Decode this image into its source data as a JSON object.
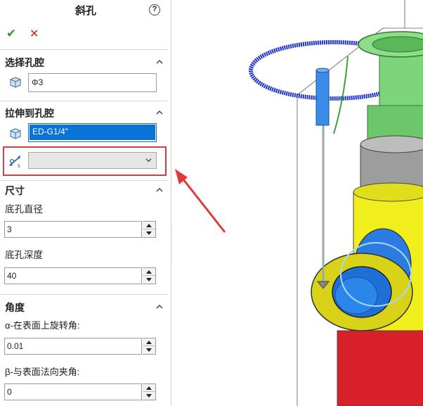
{
  "panel": {
    "title": "斜孔",
    "help_icon": "?",
    "ok_icon": "✔",
    "cancel_icon": "✕",
    "section_hole": {
      "heading": "选择孔腔",
      "value": "Φ3"
    },
    "section_extrude": {
      "heading": "拉伸到孔腔",
      "selected_value": "ED-G1/4\"",
      "combo_value": ""
    },
    "section_size": {
      "heading": "尺寸",
      "diameter_label": "底孔直径",
      "diameter_value": "3",
      "depth_label": "底孔深度",
      "depth_value": "40"
    },
    "section_angle": {
      "heading": "角度",
      "alpha_label": "α-在表面上旋转角:",
      "alpha_value": "0.01",
      "beta_label": "β-与表面法向夹角:",
      "beta_value": "0"
    }
  },
  "icons": {
    "ok": "checkmark-icon",
    "cancel": "close-icon",
    "help": "help-icon",
    "solid": "solid-body-icon",
    "dimension": "dimension-icon",
    "collapse": "chevron-up-icon"
  },
  "colors": {
    "accent": "#0a73d8",
    "highlight_box": "#e03a3a",
    "ok": "#2e9a2e",
    "cancel": "#d12020"
  }
}
